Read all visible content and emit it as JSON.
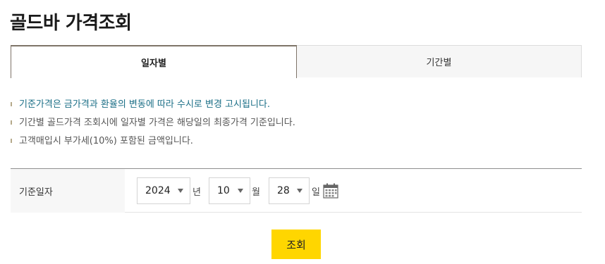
{
  "page": {
    "title": "골드바 가격조회"
  },
  "tabs": [
    {
      "label": "일자별",
      "active": true
    },
    {
      "label": "기간별",
      "active": false
    }
  ],
  "notes": [
    "기준가격은 금가격과 환율의 변동에 따라 수시로 변경 고시됩니다.",
    "기간별 골드가격 조회시에 일자별 가격은 해당일의 최종가격 기준입니다.",
    "고객매입시 부가세(10%) 포함된 금액입니다."
  ],
  "form": {
    "label": "기준일자",
    "year": {
      "value": "2024",
      "unit": "년"
    },
    "month": {
      "value": "10",
      "unit": "월"
    },
    "day": {
      "value": "28",
      "unit": "일"
    },
    "calendar_icon": "calendar-icon"
  },
  "search_button": {
    "label": "조회"
  },
  "colors": {
    "accent": "#ffd600",
    "note_highlight": "#1a6e86",
    "tab_border": "#7e7468"
  }
}
